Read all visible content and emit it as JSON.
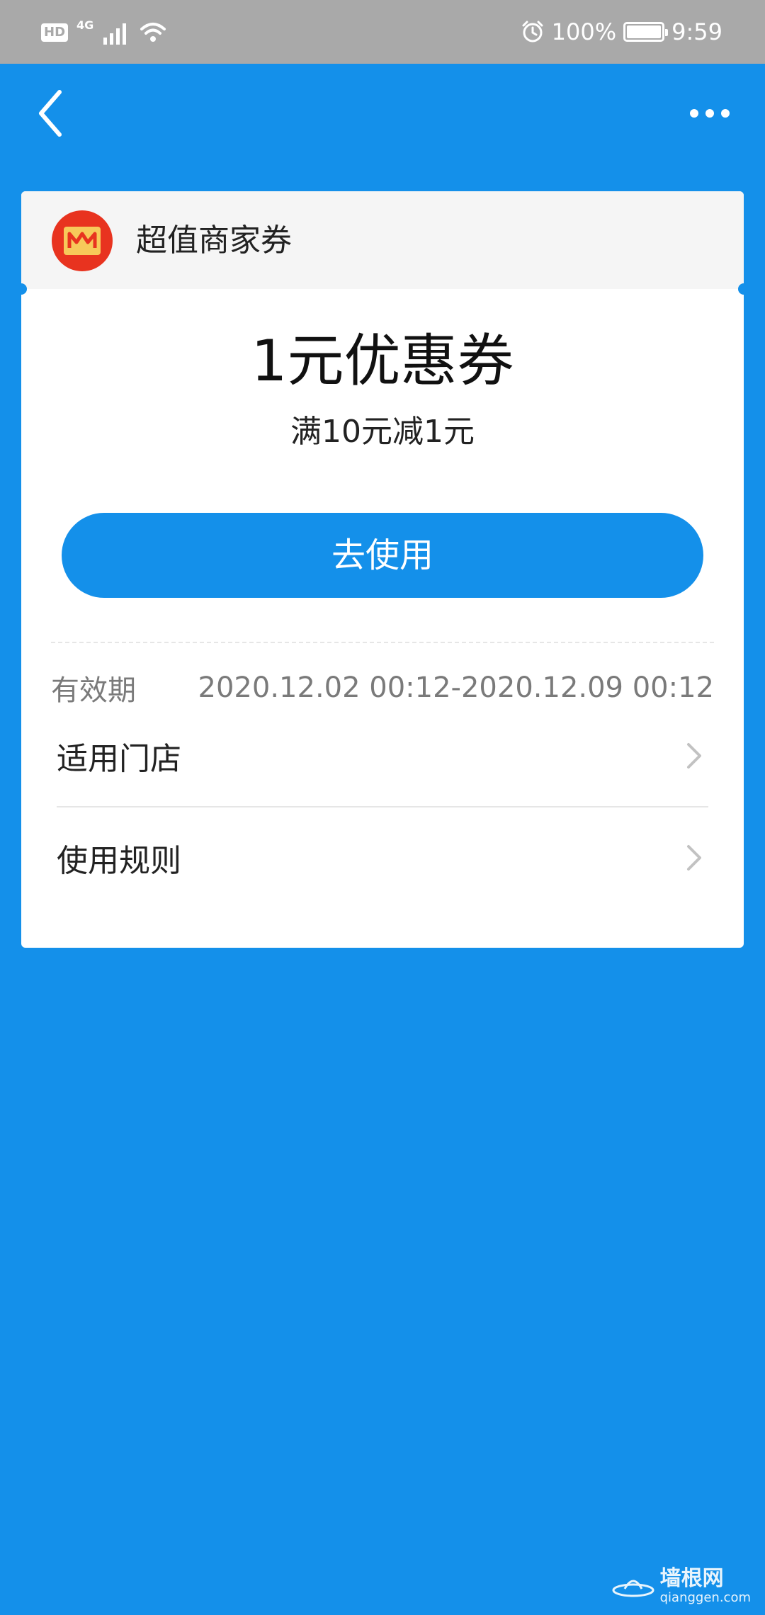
{
  "status_bar": {
    "hd": "HD",
    "network": "4G",
    "battery": "100%",
    "time": "9:59"
  },
  "card": {
    "shop_name": "超值商家券",
    "coupon_title": "1元优惠券",
    "coupon_condition": "满10元减1元",
    "use_button_label": "去使用",
    "validity_label": "有效期",
    "validity_value": "2020.12.02 00:12-2020.12.09 00:12",
    "rows": [
      {
        "label": "适用门店"
      },
      {
        "label": "使用规则"
      }
    ]
  },
  "watermark": {
    "text": "墙根网",
    "sub": "qianggen.com"
  },
  "colors": {
    "background": "#1490ea",
    "status_bar": "#a9a9a9",
    "card": "#ffffff",
    "card_header": "#f5f5f5",
    "logo_red": "#e8331f",
    "logo_gold": "#f7c95a"
  }
}
